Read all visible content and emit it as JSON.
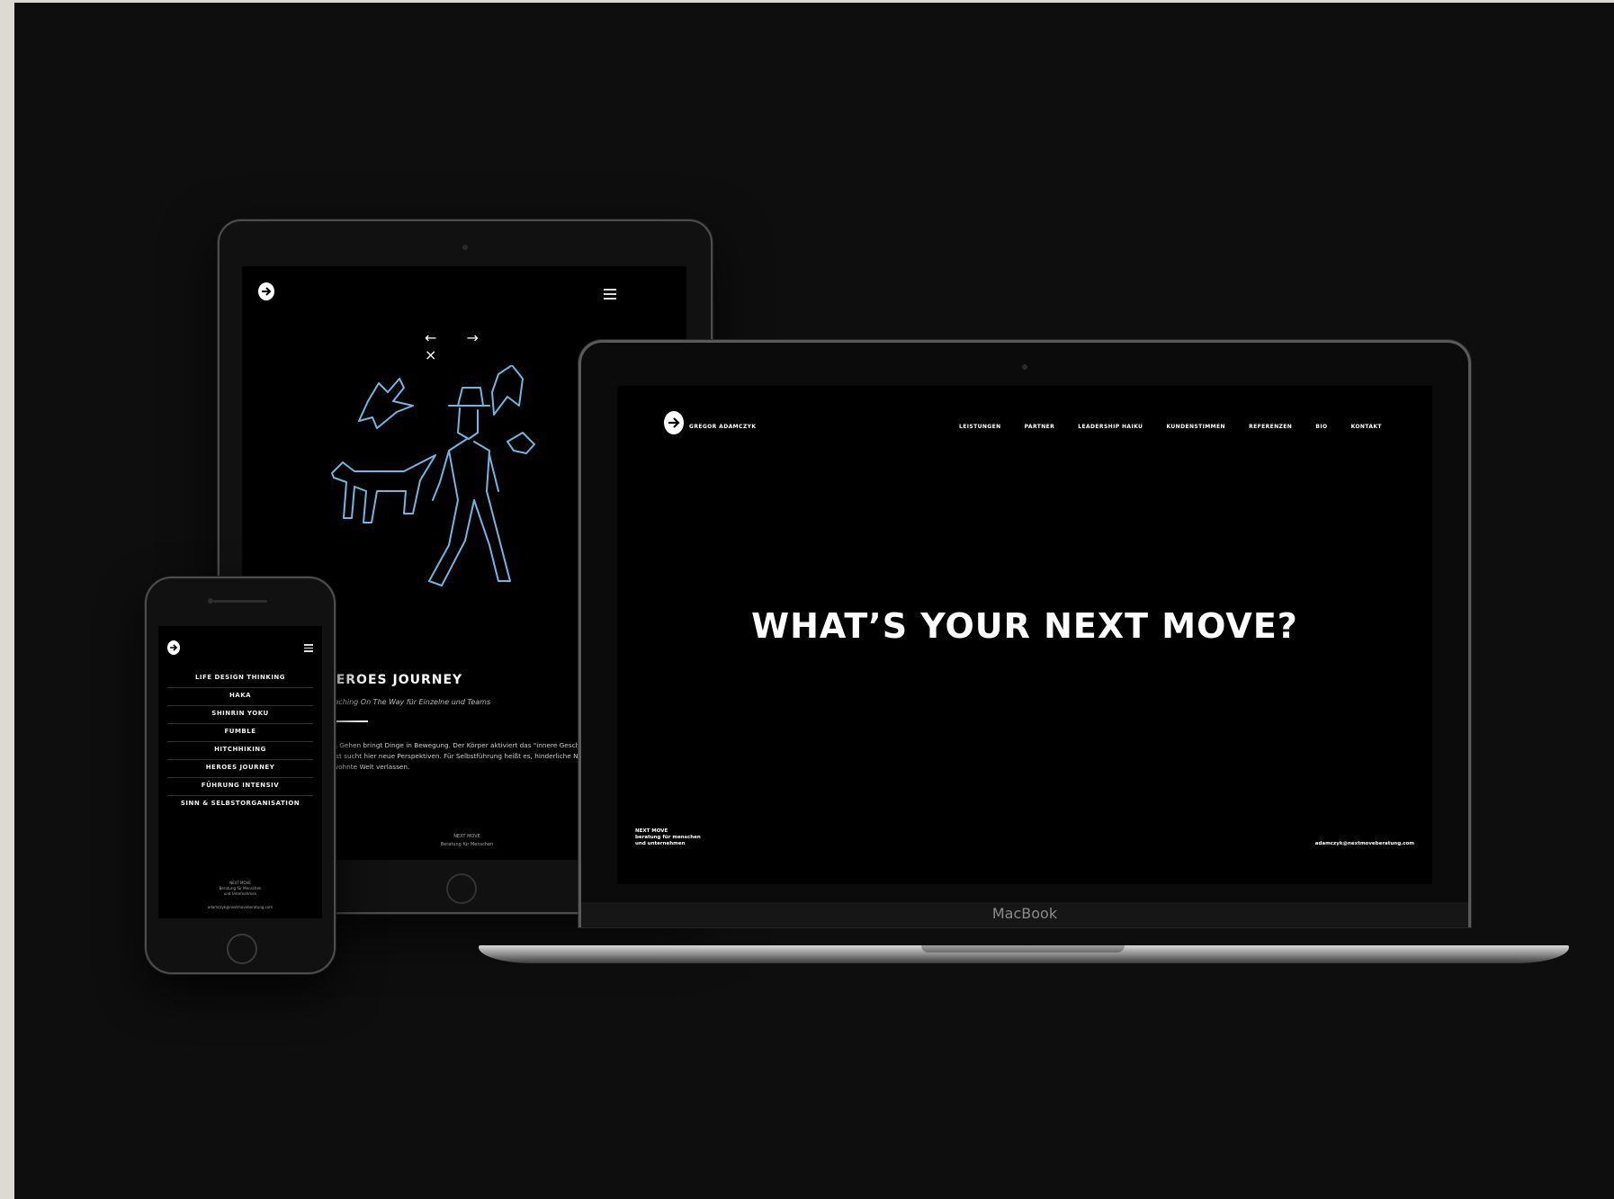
{
  "tablet": {
    "nav_arrows": "← → ×",
    "title": "HEROES JOURNEY",
    "subtitle": "Coaching On The Way für Einzelne und Teams",
    "body": "Das Gehen bringt Dinge in Bewegung. Der Körper aktiviert das \"innere Geschehen\" und verstummt. Der Geist sucht hier neue Perspektiven. Für Selbstführung heißt es, hinderliche Narrative aufdecken. Mut fassen, gewohnte Welt verlassen.",
    "footer_line1": "NEXT MOVE",
    "footer_line2": "Beratung für Menschen"
  },
  "phone": {
    "menu": [
      "LIFE DESIGN THINKING",
      "HAKA",
      "SHINRIN YOKU",
      "FUMBLE",
      "HITCHHIKING",
      "HEROES JOURNEY",
      "FÜHRUNG INTENSIV",
      "SINN & SELBSTORGANISATION"
    ],
    "footer_line1": "NEXT MOVE",
    "footer_line2": "Beratung für Menschen",
    "footer_line3": "und Unternehmen",
    "email": "adamczyk@nextmoveberatung.com"
  },
  "laptop": {
    "brand": "GREGOR ADAMCZYK",
    "nav": [
      "LEISTUNGEN",
      "PARTNER",
      "LEADERSHIP HAIKU",
      "KUNDENSTIMMEN",
      "REFERENZEN",
      "BIO",
      "KONTAKT"
    ],
    "hero": "WHAT’S YOUR NEXT MOVE?",
    "footer_line1": "NEXT MOVE",
    "footer_line2": "beratung für menschen",
    "footer_line3": "und unternehmen",
    "email": "adamczyk@nextmoveberatung.com",
    "device_label": "MacBook"
  },
  "colors": {
    "background": "#0e0e0e",
    "outer": "#dcdad3",
    "illustration": "#6fb7e0"
  }
}
